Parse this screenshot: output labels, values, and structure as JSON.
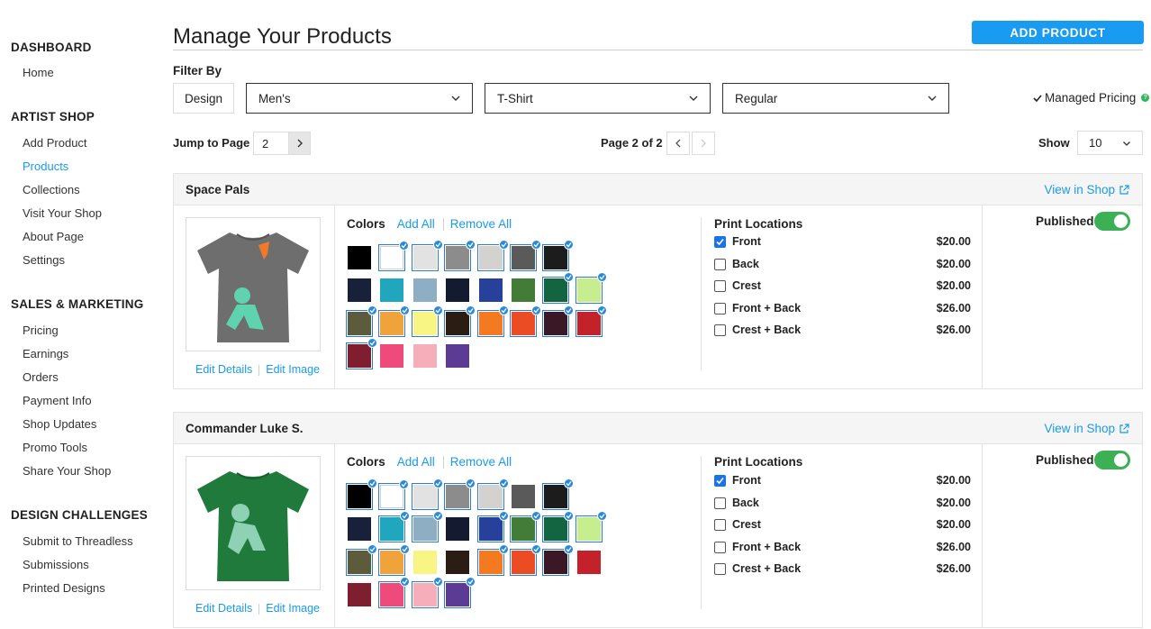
{
  "sidebar": {
    "sections": [
      {
        "heading": "DASHBOARD",
        "items": [
          "Home"
        ]
      },
      {
        "heading": "ARTIST SHOP",
        "items": [
          "Add Product",
          "Products",
          "Collections",
          "Visit Your Shop",
          "About Page",
          "Settings"
        ]
      },
      {
        "heading": "SALES & MARKETING",
        "items": [
          "Pricing",
          "Earnings",
          "Orders",
          "Payment Info",
          "Shop Updates",
          "Promo Tools",
          "Share Your Shop"
        ]
      },
      {
        "heading": "DESIGN CHALLENGES",
        "items": [
          "Submit to Threadless",
          "Submissions",
          "Printed Designs"
        ]
      }
    ],
    "active_item": "Products",
    "active_color": "#1a9be6"
  },
  "header": {
    "title": "Manage Your Products",
    "add_button": "ADD PRODUCT",
    "accent": "#1a9bf2"
  },
  "filters": {
    "label": "Filter By",
    "design_button": "Design",
    "selects": [
      "Men's",
      "T-Shirt",
      "Regular"
    ],
    "managed_pricing": "Managed Pricing",
    "managed_icon": "check-icon",
    "help_icon": "question-icon"
  },
  "pagination": {
    "jump_label": "Jump to Page",
    "jump_value": "2",
    "page_info": "Page 2 of 2",
    "show_label": "Show",
    "show_value": "10"
  },
  "swatch_colors": [
    "#000000",
    "#ffffff",
    "#e2e2e2",
    "#8c8c8c",
    "#d4d2cf",
    "#5a5a5a",
    "#1c1c1c",
    "#18203a",
    "#20a7bd",
    "#8eaec4",
    "#141a30",
    "#27419a",
    "#437c37",
    "#136440",
    "#c6ee8e",
    "#5c5c3c",
    "#f0a33a",
    "#f8f585",
    "#2b1c14",
    "#f47a22",
    "#ec4c23",
    "#3b1826",
    "#c4222b",
    "#7e1e2e",
    "#ee4b7c",
    "#f7aebb",
    "#5b3b94"
  ],
  "products": [
    {
      "name": "Space Pals",
      "view_link": "View in Shop",
      "tee_color": "#6e6e6e",
      "edit_details": "Edit Details",
      "edit_image": "Edit Image",
      "colors_label": "Colors",
      "add_all": "Add All",
      "remove_all": "Remove All",
      "selected": [
        1,
        2,
        3,
        4,
        5,
        6,
        13,
        14,
        15,
        16,
        17,
        18,
        19,
        20,
        21,
        22,
        23
      ],
      "print_label": "Print Locations",
      "locations": [
        {
          "name": "Front",
          "price": "$20.00",
          "checked": true
        },
        {
          "name": "Back",
          "price": "$20.00",
          "checked": false
        },
        {
          "name": "Crest",
          "price": "$20.00",
          "checked": false
        },
        {
          "name": "Front + Back",
          "price": "$26.00",
          "checked": false
        },
        {
          "name": "Crest + Back",
          "price": "$26.00",
          "checked": false
        }
      ],
      "published_label": "Published",
      "published": true
    },
    {
      "name": "Commander Luke S.",
      "view_link": "View in Shop",
      "tee_color": "#1f7a3c",
      "edit_details": "Edit Details",
      "edit_image": "Edit Image",
      "colors_label": "Colors",
      "add_all": "Add All",
      "remove_all": "Remove All",
      "selected": [
        0,
        1,
        2,
        3,
        4,
        6,
        8,
        9,
        11,
        12,
        13,
        14,
        15,
        16,
        19,
        20,
        21,
        24,
        25,
        26
      ],
      "print_label": "Print Locations",
      "locations": [
        {
          "name": "Front",
          "price": "$20.00",
          "checked": true
        },
        {
          "name": "Back",
          "price": "$20.00",
          "checked": false
        },
        {
          "name": "Crest",
          "price": "$20.00",
          "checked": false
        },
        {
          "name": "Front + Back",
          "price": "$26.00",
          "checked": false
        },
        {
          "name": "Crest + Back",
          "price": "$26.00",
          "checked": false
        }
      ],
      "published_label": "Published",
      "published": true
    }
  ]
}
